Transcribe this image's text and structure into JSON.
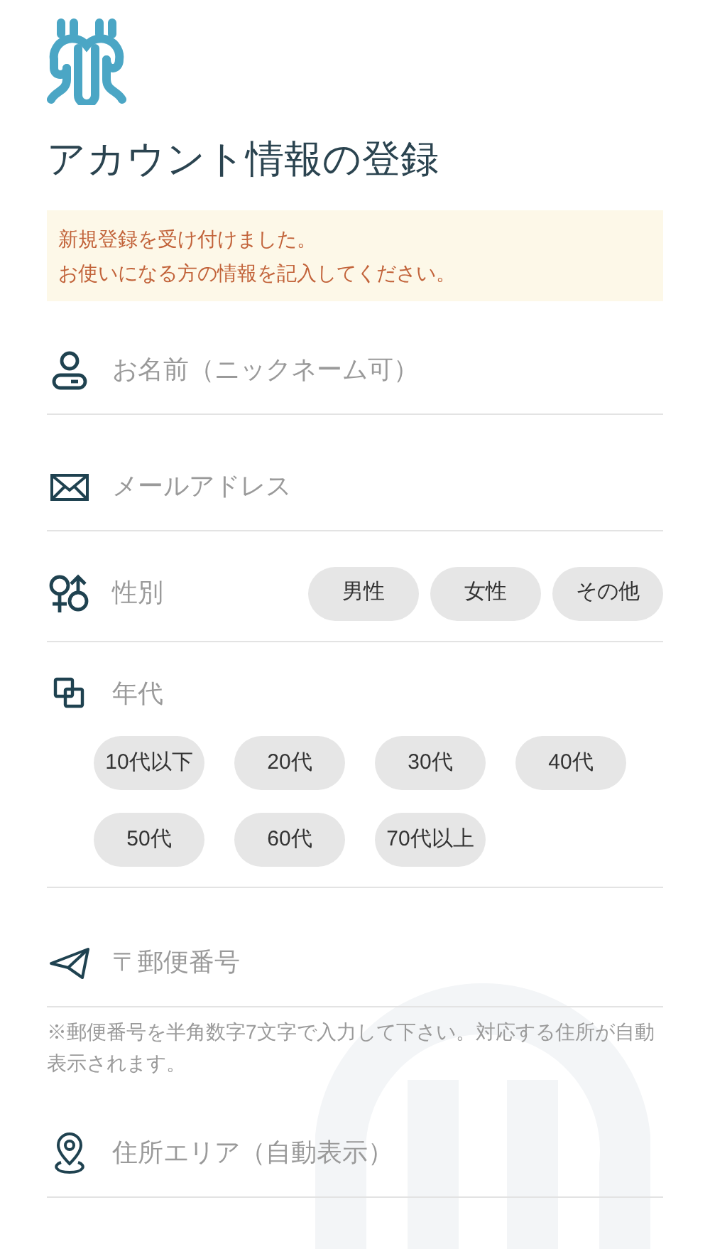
{
  "title": "アカウント情報の登録",
  "notice": [
    "新規登録を受け付けました。",
    "お使いになる方の情報を記入してください。"
  ],
  "name_field": {
    "placeholder": "お名前（ニックネーム可）"
  },
  "email_field": {
    "placeholder": "メールアドレス"
  },
  "gender": {
    "label": "性別",
    "options": [
      {
        "label": "男性",
        "selected": false
      },
      {
        "label": "女性",
        "selected": false
      },
      {
        "label": "その他",
        "selected": false
      }
    ]
  },
  "age_group": {
    "label": "年代",
    "options": [
      {
        "label": "10代以下",
        "selected": false
      },
      {
        "label": "20代",
        "selected": false
      },
      {
        "label": "30代",
        "selected": false
      },
      {
        "label": "40代",
        "selected": false
      },
      {
        "label": "50代",
        "selected": false
      },
      {
        "label": "60代",
        "selected": false
      },
      {
        "label": "70代以上",
        "selected": false
      }
    ]
  },
  "postal_field": {
    "placeholder": "〒郵便番号",
    "note": "※郵便番号を半角数字7文字で入力して下さい。対応する住所が自動表示されます。"
  },
  "address_field": {
    "placeholder": "住所エリア（自動表示）"
  }
}
